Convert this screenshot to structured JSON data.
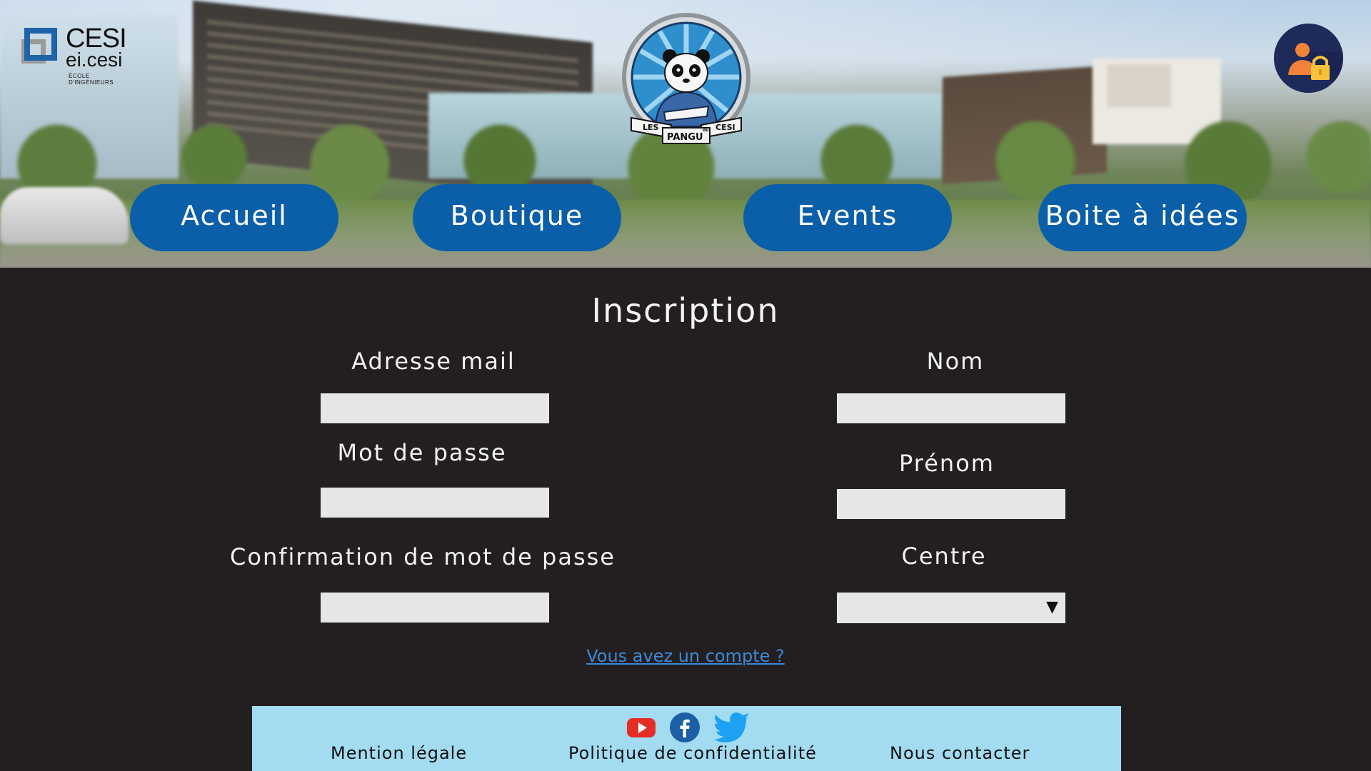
{
  "header": {
    "logo": {
      "brand": "CESI",
      "sub": "ei.cesi",
      "tagline": "ÉCOLE D'INGÉNIEURS",
      "icon": "cesi-logo-icon"
    },
    "badge": {
      "icon": "panda-badge-icon",
      "text_left": "LES",
      "text_center": "PANGU",
      "text_small": "du",
      "text_right": "CESI"
    },
    "profile_icon": "user-lock-icon",
    "nav": [
      {
        "label": "Accueil"
      },
      {
        "label": "Boutique"
      },
      {
        "label": "Events"
      },
      {
        "label": "Boite à idées"
      }
    ],
    "colors": {
      "nav_button": "#0b5ea8",
      "profile_circle": "#1d2a5a"
    }
  },
  "form": {
    "title": "Inscription",
    "fields": {
      "email": {
        "label": "Adresse mail",
        "value": "",
        "placeholder": ""
      },
      "password": {
        "label": "Mot de passe",
        "value": "",
        "placeholder": ""
      },
      "password_confirm": {
        "label": "Confirmation de mot de passe",
        "value": "",
        "placeholder": ""
      },
      "last_name": {
        "label": "Nom",
        "value": "",
        "placeholder": ""
      },
      "first_name": {
        "label": "Prénom",
        "value": "",
        "placeholder": ""
      },
      "centre": {
        "label": "Centre",
        "selected": "",
        "arrow_icon": "triangle-down-icon"
      }
    },
    "login_link": "Vous avez un compte ?"
  },
  "footer": {
    "social": [
      {
        "icon": "youtube-icon",
        "color": "#e52d27"
      },
      {
        "icon": "facebook-icon",
        "color": "#1d5fa6"
      },
      {
        "icon": "twitter-icon",
        "color": "#1da1f2"
      }
    ],
    "links": {
      "legal": "Mention légale",
      "privacy": "Politique de confidentialité",
      "contact": "Nous contacter"
    },
    "background": "#a3dbf0"
  },
  "page_background": "#231f20"
}
